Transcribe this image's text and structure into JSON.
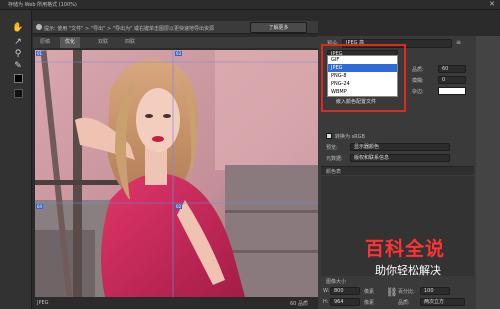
{
  "title_bar": {
    "title": "存储为 Web 所用格式 (100%)",
    "close_icon": "close-icon"
  },
  "tools": [
    "hand-icon",
    "slice-select-icon",
    "zoom-icon",
    "eyedropper-icon"
  ],
  "colors": {
    "eyedropper_swatch": "#000000",
    "accent_selected": "#2f6bd8",
    "highlight_box": "#e0281f"
  },
  "hint_bar": {
    "text": "提示:  使用 \"文件\" > \"导出\" > \"导出为\" 或右键单击图层以更快速地导出资源",
    "button_label": "了解更多"
  },
  "view_tabs": [
    "原稿",
    "优化",
    "双联",
    "四联"
  ],
  "active_tab": "优化",
  "canvas": {
    "format_badge": "JPEG",
    "slice_label_1": "01",
    "slice_label_2": "03",
    "slice_label_3": "04",
    "slice_label_4": "02"
  },
  "status_bar": {
    "left_text": "JPEG",
    "right_text": "60 品质"
  },
  "panel": {
    "preset_label": "预设:",
    "preset_value": "JPEG 高",
    "format_value": "JPEG",
    "quality_label": "品质:",
    "quality_value": "60",
    "blur_label": "模糊:",
    "blur_value": "0",
    "matte_label": "杂边:",
    "embed_profile_label": "嵌入颜色配置文件",
    "convert_srgb_label": "转换为 sRGB",
    "preview_label": "预览:",
    "preview_value": "显示器颜色",
    "metadata_label": "元数据:",
    "metadata_value": "版权和联系信息",
    "color_table_label": "颜色表",
    "image_size_label": "图像大小",
    "width_label": "W:",
    "width_value": "800",
    "height_label": "H:",
    "height_value": "964",
    "px_unit_1": "像素",
    "px_unit_2": "像素",
    "percent_label": "百分比:",
    "percent_value": "100",
    "quality2_label": "品质:",
    "quality2_value": "两次立方"
  },
  "format_dropdown": {
    "options": [
      "GIF",
      "JPEG",
      "PNG-8",
      "PNG-24",
      "WBMP"
    ],
    "selected": "JPEG"
  },
  "watermark": {
    "main": "百科全说",
    "sub": "助你轻松解决"
  }
}
